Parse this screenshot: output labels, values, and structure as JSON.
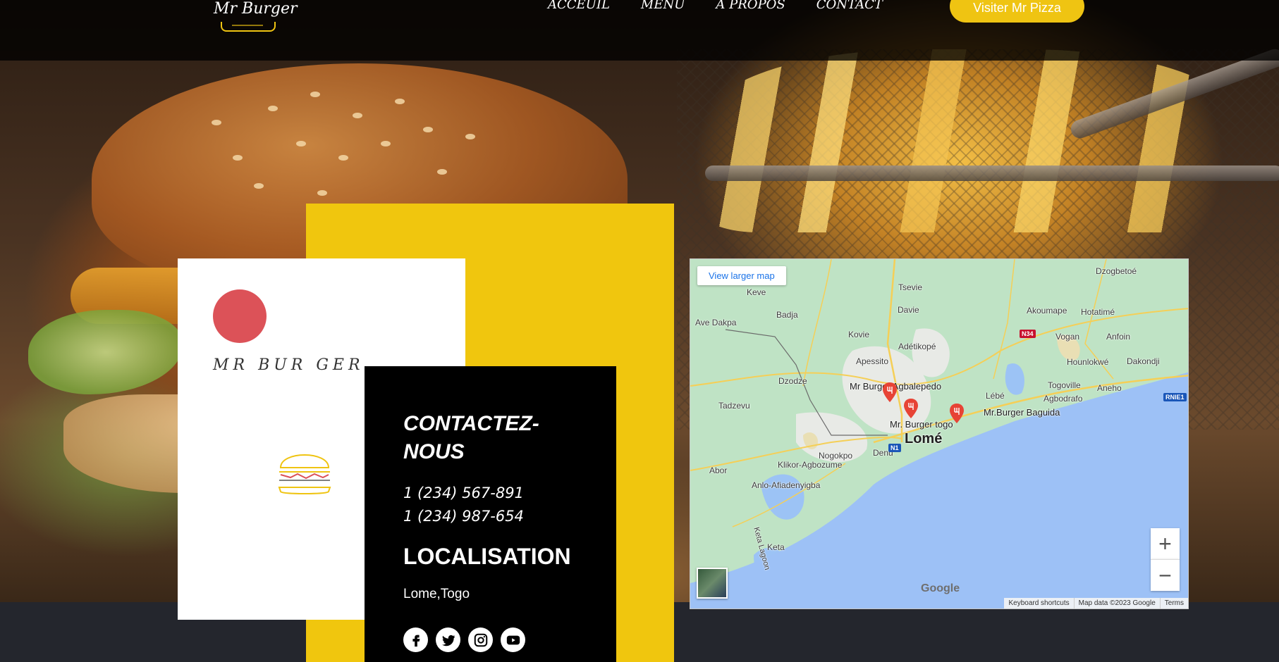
{
  "navbar": {
    "logo_text": "Mr Burger",
    "links": [
      "ACCEUIL",
      "MENU",
      "A PROPOS",
      "CONTACT"
    ],
    "cta_label": "Visiter Mr Pizza",
    "accent_color": "#efc412"
  },
  "brand_card": {
    "wordmark": "MR BUR GER",
    "circle_color": "#dc5258"
  },
  "contact": {
    "title": "CONTACTEZ-NOUS",
    "phones": [
      "1 (234) 567-891",
      "1 (234) 987-654"
    ],
    "location_title": "LOCALISATION",
    "location": "Lome,Togo",
    "socials": [
      "facebook-icon",
      "twitter-icon",
      "instagram-icon",
      "youtube-icon"
    ]
  },
  "map": {
    "view_larger_label": "View larger map",
    "city": "Lomé",
    "places": [
      "Mr Burger Agbalepedo",
      "Mr. Burger togo",
      "Mr.Burger Baguida"
    ],
    "localities": [
      "Keve",
      "Tsevie",
      "Dzogbetoé",
      "Badja",
      "Davie",
      "Ave Dakpa",
      "Akoumape",
      "Hotatimé",
      "Kovie",
      "Adétikopé",
      "Vogan",
      "Anfoin",
      "Apessito",
      "Hounlokwé",
      "Dakondji",
      "Dzodze",
      "Togoville",
      "Aneho",
      "Tadzevu",
      "Lébé",
      "Agbodrafo",
      "Denu",
      "Nogokpo",
      "Klikor-Agbozume",
      "Abor",
      "Anlo-Afiadenyigba",
      "Keta",
      "Keta Lagoon"
    ],
    "route_labels": [
      "N34",
      "N1",
      "RNIE1"
    ],
    "zoom_in": "+",
    "zoom_out": "−",
    "google_label": "Google",
    "attribution": [
      "Keyboard shortcuts",
      "Map data ©2023 Google",
      "Terms"
    ]
  }
}
